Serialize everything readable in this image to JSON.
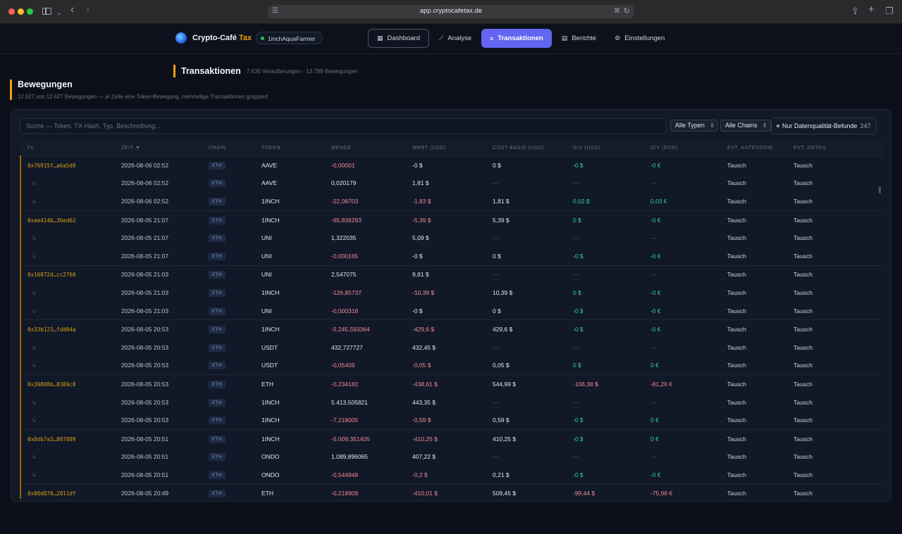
{
  "browser": {
    "url": "app.cryptocafetax.de"
  },
  "app": {
    "brand_name": "Crypto-Café",
    "brand_suffix": "Tax",
    "user": "1inchAquaFarmer",
    "nav": [
      {
        "label": "Dashboard",
        "icon": "grid-icon"
      },
      {
        "label": "Analyse",
        "icon": "chart-icon"
      },
      {
        "label": "Transaktionen",
        "icon": "list-icon"
      },
      {
        "label": "Berichte",
        "icon": "document-icon"
      },
      {
        "label": "Einstellungen",
        "icon": "gear-icon"
      }
    ],
    "active_nav": "Transaktionen"
  },
  "page": {
    "title": "Transaktionen",
    "subtitle": "7.635 Veräußerungen · 13.789 Bewegungen",
    "section_title": "Bewegungen",
    "section_subtitle": "12.627 von 12.627 Bewegungen — je Zeile eine Token-Bewegung, mehrteilige Transaktionen gruppiert"
  },
  "filters": {
    "search_placeholder": "Suche — Token, TX-Hash, Typ, Beschreibung...",
    "types": "Alle Typen",
    "chains": "Alle Chains",
    "dq_label": "Nur Datenqualität-Befunde",
    "dq_count": "247"
  },
  "table": {
    "columns": [
      "TX",
      "ZEIT ▼",
      "CHAIN",
      "TOKEN",
      "MENGE",
      "WERT (USD)",
      "COST BASIS (USD)",
      "G/V (USD)",
      "G/V (EUR)",
      "EVT. KATEGORIE",
      "EVT. DETAIL"
    ],
    "rows": [
      {
        "tx": "0x76915f…a6a5d9",
        "time": "2026-08-06 02:52",
        "chain": "ETH",
        "token": "AAVE",
        "amount": "-0,00001",
        "amount_sign": "neg",
        "value": "-0 $",
        "value_sign": "plain",
        "cost": "0 $",
        "gv_usd": "-0 $",
        "gv_usd_sign": "pos",
        "gv_eur": "-0 €",
        "gv_eur_sign": "pos",
        "cat": "Tausch",
        "detail": "Tausch"
      },
      {
        "tx": "↳",
        "time": "2026-08-06 02:52",
        "chain": "ETH",
        "token": "AAVE",
        "amount": "0,020179",
        "amount_sign": "plain",
        "value": "1,81 $",
        "value_sign": "plain",
        "cost": "—",
        "gv_usd": "—",
        "gv_usd_sign": "muted",
        "gv_eur": "—",
        "gv_eur_sign": "muted",
        "cat": "Tausch",
        "detail": "Tausch"
      },
      {
        "tx": "↳",
        "time": "2026-08-06 02:52",
        "chain": "ETH",
        "token": "1INCH",
        "amount": "-22,08703",
        "amount_sign": "neg",
        "value": "-1,83 $",
        "value_sign": "neg",
        "cost": "1,81 $",
        "gv_usd": "0,02 $",
        "gv_usd_sign": "pos",
        "gv_eur": "0,03 €",
        "gv_eur_sign": "pos",
        "cat": "Tausch",
        "detail": "Tausch"
      },
      {
        "tx": "0xae4146…36ed62",
        "time": "2026-08-05 21:07",
        "chain": "ETH",
        "token": "1INCH",
        "amount": "-65,836293",
        "amount_sign": "neg",
        "value": "-5,39 $",
        "value_sign": "neg",
        "cost": "5,39 $",
        "gv_usd": "0 $",
        "gv_usd_sign": "pos",
        "gv_eur": "-0 €",
        "gv_eur_sign": "pos",
        "cat": "Tausch",
        "detail": "Tausch"
      },
      {
        "tx": "↳",
        "time": "2026-08-05 21:07",
        "chain": "ETH",
        "token": "UNI",
        "amount": "1,322035",
        "amount_sign": "plain",
        "value": "5,09 $",
        "value_sign": "plain",
        "cost": "—",
        "gv_usd": "—",
        "gv_usd_sign": "muted",
        "gv_eur": "—",
        "gv_eur_sign": "muted",
        "cat": "Tausch",
        "detail": "Tausch"
      },
      {
        "tx": "↳",
        "time": "2026-08-05 21:07",
        "chain": "ETH",
        "token": "UNI",
        "amount": "-0,000165",
        "amount_sign": "neg",
        "value": "-0 $",
        "value_sign": "plain",
        "cost": "0 $",
        "gv_usd": "-0 $",
        "gv_usd_sign": "pos",
        "gv_eur": "-0 €",
        "gv_eur_sign": "pos",
        "cat": "Tausch",
        "detail": "Tausch"
      },
      {
        "tx": "0x16872d…cc2760",
        "time": "2026-08-05 21:03",
        "chain": "ETH",
        "token": "UNI",
        "amount": "2,547075",
        "amount_sign": "plain",
        "value": "9,81 $",
        "value_sign": "plain",
        "cost": "—",
        "gv_usd": "—",
        "gv_usd_sign": "muted",
        "gv_eur": "—",
        "gv_eur_sign": "muted",
        "cat": "Tausch",
        "detail": "Tausch"
      },
      {
        "tx": "↳",
        "time": "2026-08-05 21:03",
        "chain": "ETH",
        "token": "1INCH",
        "amount": "-126,85737",
        "amount_sign": "neg",
        "value": "-10,39 $",
        "value_sign": "neg",
        "cost": "10,39 $",
        "gv_usd": "0 $",
        "gv_usd_sign": "pos",
        "gv_eur": "-0 €",
        "gv_eur_sign": "pos",
        "cat": "Tausch",
        "detail": "Tausch"
      },
      {
        "tx": "↳",
        "time": "2026-08-05 21:03",
        "chain": "ETH",
        "token": "UNI",
        "amount": "-0,000318",
        "amount_sign": "neg",
        "value": "-0 $",
        "value_sign": "plain",
        "cost": "0 $",
        "gv_usd": "-0 $",
        "gv_usd_sign": "pos",
        "gv_eur": "-0 €",
        "gv_eur_sign": "pos",
        "cat": "Tausch",
        "detail": "Tausch"
      },
      {
        "tx": "0x33b123…fdd04a",
        "time": "2026-08-05 20:53",
        "chain": "ETH",
        "token": "1INCH",
        "amount": "-5.245,593364",
        "amount_sign": "neg",
        "value": "-429,6 $",
        "value_sign": "neg",
        "cost": "429,6 $",
        "gv_usd": "-0 $",
        "gv_usd_sign": "pos",
        "gv_eur": "-0 €",
        "gv_eur_sign": "pos",
        "cat": "Tausch",
        "detail": "Tausch"
      },
      {
        "tx": "↳",
        "time": "2026-08-05 20:53",
        "chain": "ETH",
        "token": "USDT",
        "amount": "432,727727",
        "amount_sign": "plain",
        "value": "432,45 $",
        "value_sign": "plain",
        "cost": "—",
        "gv_usd": "—",
        "gv_usd_sign": "muted",
        "gv_eur": "—",
        "gv_eur_sign": "muted",
        "cat": "Tausch",
        "detail": "Tausch"
      },
      {
        "tx": "↳",
        "time": "2026-08-05 20:53",
        "chain": "ETH",
        "token": "USDT",
        "amount": "-0,05409",
        "amount_sign": "neg",
        "value": "-0,05 $",
        "value_sign": "neg",
        "cost": "0,05 $",
        "gv_usd": "0 $",
        "gv_usd_sign": "pos",
        "gv_eur": "0 €",
        "gv_eur_sign": "pos",
        "cat": "Tausch",
        "detail": "Tausch"
      },
      {
        "tx": "0x39808b…8309c8",
        "time": "2026-08-05 20:53",
        "chain": "ETH",
        "token": "ETH",
        "amount": "-0,234182",
        "amount_sign": "neg",
        "value": "-438,61 $",
        "value_sign": "neg",
        "cost": "544,99 $",
        "gv_usd": "-106,38 $",
        "gv_usd_sign": "neg",
        "gv_eur": "-81,26 €",
        "gv_eur_sign": "neg",
        "cat": "Tausch",
        "detail": "Tausch"
      },
      {
        "tx": "↳",
        "time": "2026-08-05 20:53",
        "chain": "ETH",
        "token": "1INCH",
        "amount": "5.413,505821",
        "amount_sign": "plain",
        "value": "443,35 $",
        "value_sign": "plain",
        "cost": "—",
        "gv_usd": "—",
        "gv_usd_sign": "muted",
        "gv_eur": "—",
        "gv_eur_sign": "muted",
        "cat": "Tausch",
        "detail": "Tausch"
      },
      {
        "tx": "↳",
        "time": "2026-08-05 20:53",
        "chain": "ETH",
        "token": "1INCH",
        "amount": "-7,218005",
        "amount_sign": "neg",
        "value": "-0,59 $",
        "value_sign": "neg",
        "cost": "0,59 $",
        "gv_usd": "-0 $",
        "gv_usd_sign": "pos",
        "gv_eur": "0 €",
        "gv_eur_sign": "pos",
        "cat": "Tausch",
        "detail": "Tausch"
      },
      {
        "tx": "0x8db7a3…807889",
        "time": "2026-08-05 20:51",
        "chain": "ETH",
        "token": "1INCH",
        "amount": "-5.009,351405",
        "amount_sign": "neg",
        "value": "-410,25 $",
        "value_sign": "neg",
        "cost": "410,25 $",
        "gv_usd": "-0 $",
        "gv_usd_sign": "pos",
        "gv_eur": "0 €",
        "gv_eur_sign": "pos",
        "cat": "Tausch",
        "detail": "Tausch"
      },
      {
        "tx": "↳",
        "time": "2026-08-05 20:51",
        "chain": "ETH",
        "token": "ONDO",
        "amount": "1.089,896065",
        "amount_sign": "plain",
        "value": "407,22 $",
        "value_sign": "plain",
        "cost": "—",
        "gv_usd": "—",
        "gv_usd_sign": "muted",
        "gv_eur": "—",
        "gv_eur_sign": "muted",
        "cat": "Tausch",
        "detail": "Tausch"
      },
      {
        "tx": "↳",
        "time": "2026-08-05 20:51",
        "chain": "ETH",
        "token": "ONDO",
        "amount": "-0,544948",
        "amount_sign": "neg",
        "value": "-0,2 $",
        "value_sign": "neg",
        "cost": "0,21 $",
        "gv_usd": "-0 $",
        "gv_usd_sign": "pos",
        "gv_eur": "-0 €",
        "gv_eur_sign": "pos",
        "cat": "Tausch",
        "detail": "Tausch"
      },
      {
        "tx": "0x80d870…2011df",
        "time": "2026-08-05 20:49",
        "chain": "ETH",
        "token": "ETH",
        "amount": "-0,218909",
        "amount_sign": "neg",
        "value": "-410,01 $",
        "value_sign": "neg",
        "cost": "509,45 $",
        "gv_usd": "-99,44 $",
        "gv_usd_sign": "neg",
        "gv_eur": "-75,96 €",
        "gv_eur_sign": "neg",
        "cat": "Tausch",
        "detail": "Tausch"
      }
    ]
  }
}
